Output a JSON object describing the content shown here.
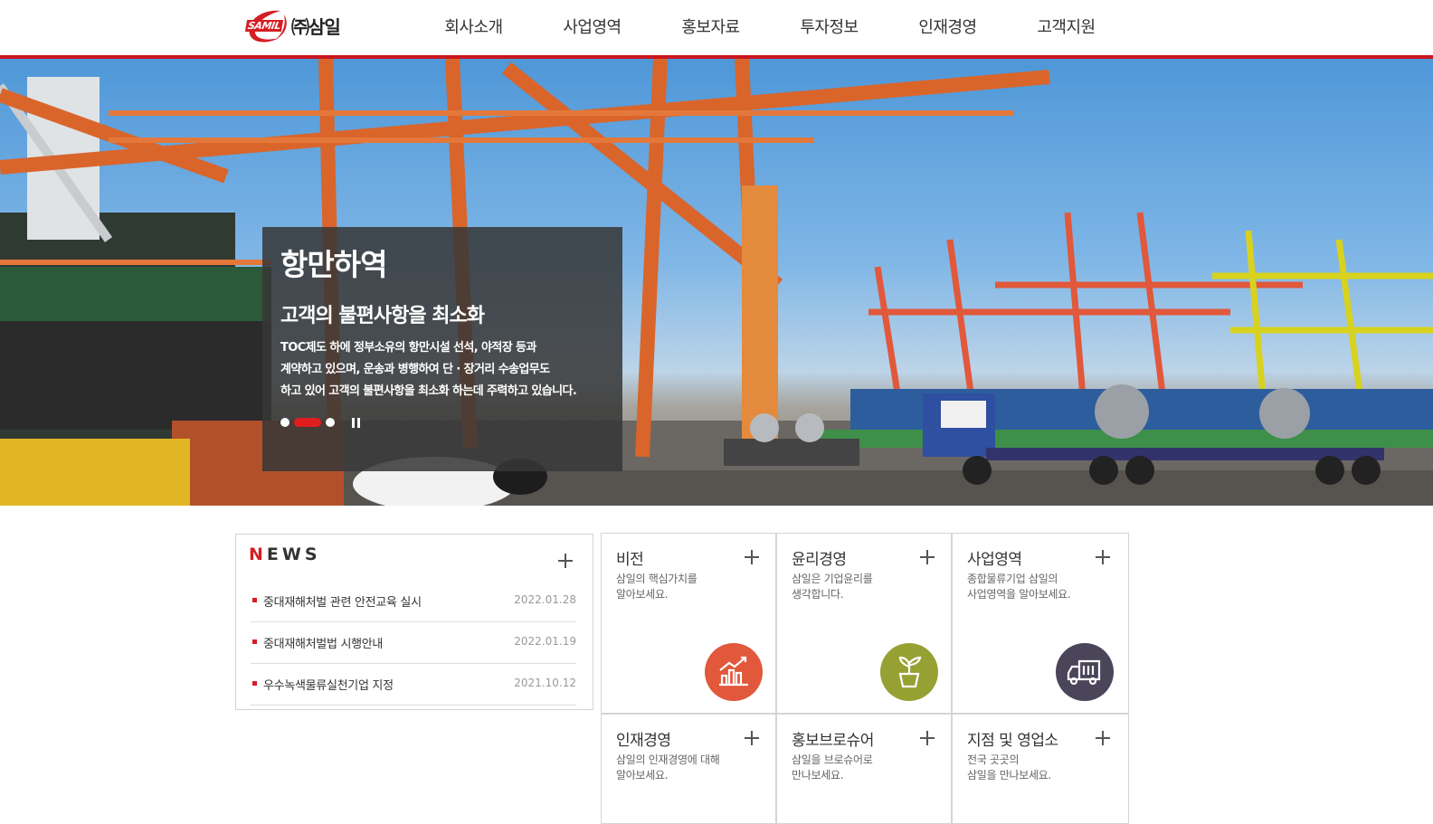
{
  "brand": {
    "logo_mark": "SAMIL",
    "logo_text": "㈜삼일"
  },
  "nav": [
    {
      "label": "회사소개"
    },
    {
      "label": "사업영역"
    },
    {
      "label": "홍보자료"
    },
    {
      "label": "투자정보"
    },
    {
      "label": "인재경영"
    },
    {
      "label": "고객지원"
    }
  ],
  "hero": {
    "title": "항만하역",
    "subtitle": "고객의 불편사항을 최소화",
    "body": [
      "TOC제도 하에 정부소유의 항만시설 선석, 야적장 등과",
      "계약하고 있으며, 운송과 병행하여 단 · 장거리 수송업무도",
      "하고 있어 고객의 불편사항을 최소화 하는데 주력하고 있습니다."
    ],
    "slides_total": 3,
    "active_slide": 2,
    "pause_icon": "pause-icon"
  },
  "news": {
    "title_first": "N",
    "title_rest": "EWS",
    "more_icon": "plus-icon",
    "items": [
      {
        "title": "중대재해처벌 관련 안전교육 실시",
        "date": "2022.01.28"
      },
      {
        "title": "중대재해처벌법 시행안내",
        "date": "2022.01.19"
      },
      {
        "title": "우수녹색물류실천기업 지정",
        "date": "2021.10.12"
      }
    ]
  },
  "cards": [
    {
      "title": "비전",
      "desc": [
        "삼일의 핵심가치를",
        "알아보세요."
      ],
      "icon": "growth-chart-icon",
      "icon_color": "#e1583b"
    },
    {
      "title": "윤리경영",
      "desc": [
        "삼일은 기업윤리를",
        "생각합니다."
      ],
      "icon": "plant-pot-icon",
      "icon_color": "#97a133"
    },
    {
      "title": "사업영역",
      "desc": [
        "종합물류기업 삼일의",
        "사업영역을 알아보세요."
      ],
      "icon": "truck-icon",
      "icon_color": "#4b4559"
    },
    {
      "title": "인재경영",
      "desc": [
        "삼일의 인재경영에 대해",
        "알아보세요."
      ],
      "icon": "",
      "icon_color": ""
    },
    {
      "title": "홍보브로슈어",
      "desc": [
        "삼일을 브로슈어로",
        "만나보세요."
      ],
      "icon": "",
      "icon_color": ""
    },
    {
      "title": "지점 및 영업소",
      "desc": [
        "전국 곳곳의",
        "삼일을 만나보세요."
      ],
      "icon": "",
      "icon_color": ""
    }
  ],
  "colors": {
    "accent": "#c8161d",
    "caption_bg": "#373737"
  }
}
